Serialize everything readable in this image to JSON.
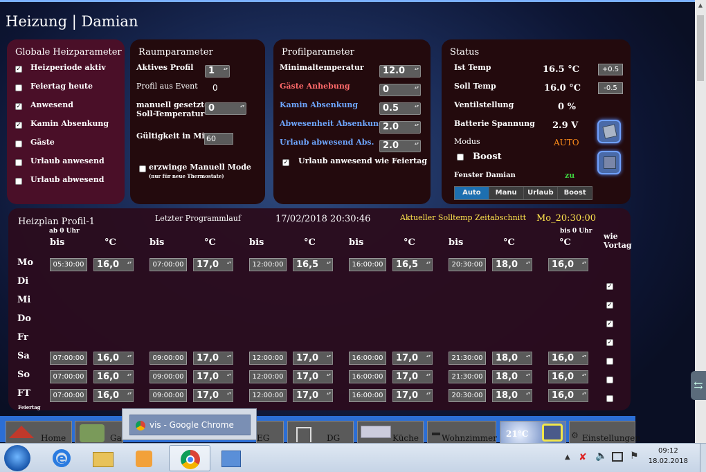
{
  "app": {
    "title": "Heizung | Damian"
  },
  "global_params": {
    "title": "Globale Heizparameter",
    "items": [
      {
        "label": "Heizperiode aktiv",
        "checked": true
      },
      {
        "label": "Feiertag heute",
        "checked": false
      },
      {
        "label": "Anwesend",
        "checked": true
      },
      {
        "label": "Kamin Absenkung",
        "checked": true
      },
      {
        "label": "Gäste",
        "checked": false
      },
      {
        "label": "Urlaub anwesend",
        "checked": false
      },
      {
        "label": "Urlaub abwesend",
        "checked": false
      }
    ]
  },
  "room_params": {
    "title": "Raumparameter",
    "active_profile_label": "Aktives Profil",
    "active_profile_value": "1",
    "profile_event_label": "Profil aus Event",
    "profile_event_value": "0",
    "manual_temp_label_1": "manuell gesetzte",
    "manual_temp_label_2": "Soll-Temperatur",
    "manual_temp_value": "0",
    "validity_label": "Gültigkeit in Min",
    "validity_value": "60",
    "force_manual_label": "erzwinge Manuell Mode",
    "force_manual_note": "(nur für neue Thermostate)"
  },
  "profile_params": {
    "title": "Profilparameter",
    "min_temp_label": "Minimaltemperatur",
    "min_temp_value": "12.0",
    "guest_raise_label": "Gäste Anhebung",
    "guest_raise_value": "0",
    "kamin_label": "Kamin Absenkung",
    "kamin_value": "0.5",
    "absence_label": "Abwesenheit Absenkung",
    "absence_value": "2.0",
    "vacation_away_label": "Urlaub abwesend Abs.",
    "vacation_away_value": "2.0",
    "vacation_holiday_label": "Urlaub anwesend wie Feiertag"
  },
  "status": {
    "title": "Status",
    "ist_label": "Ist Temp",
    "ist_value": "16.5 °C",
    "soll_label": "Soll Temp",
    "soll_value": "16.0 °C",
    "plus_label": "+0.5",
    "minus_label": "-0.5",
    "valve_label": "Ventilstellung",
    "valve_value": "0 %",
    "battery_label": "Batterie Spannung",
    "battery_value": "2.9 V",
    "mode_label": "Modus",
    "mode_value": "AUTO",
    "boost_label": "Boost",
    "window_label": "Fenster Damian",
    "window_value": "zu",
    "mode_buttons": [
      "Auto",
      "Manu",
      "Urlaub",
      "Boost"
    ],
    "colors": {
      "mode": "#ff8c1a",
      "window": "#3fd23f",
      "active_mode": "#1d6fb0"
    }
  },
  "schedule": {
    "title": "Heizplan Profil-1",
    "last_run_label": "Letzter Programmlauf",
    "last_run_value": "17/02/2018 20:30:46",
    "current_label": "Aktueller Solltemp Zeitabschnitt",
    "current_value": "Mo_20:30:00",
    "from_label": "ab 0 Uhr",
    "to_label": "bis 0 Uhr",
    "bis": "bis",
    "celsius": "°C",
    "like_prev_1": "wie",
    "like_prev_2": "Vortag",
    "holiday_note": "Feiertag",
    "days": [
      {
        "name": "Mo",
        "times": [
          "05:30:00",
          "07:00:00",
          "12:00:00",
          "16:00:00",
          "20:30:00"
        ],
        "temps": [
          "16,0",
          "17,0",
          "16,5",
          "16,5",
          "18,0",
          "16,0"
        ],
        "like_prev": null
      },
      {
        "name": "Di",
        "like_prev": true
      },
      {
        "name": "Mi",
        "like_prev": true
      },
      {
        "name": "Do",
        "like_prev": true
      },
      {
        "name": "Fr",
        "like_prev": true
      },
      {
        "name": "Sa",
        "times": [
          "07:00:00",
          "09:00:00",
          "12:00:00",
          "16:00:00",
          "21:30:00"
        ],
        "temps": [
          "16,0",
          "17,0",
          "17,0",
          "17,0",
          "18,0",
          "16,0"
        ],
        "like_prev": false
      },
      {
        "name": "So",
        "times": [
          "07:00:00",
          "09:00:00",
          "12:00:00",
          "16:00:00",
          "21:30:00"
        ],
        "temps": [
          "16,0",
          "17,0",
          "17,0",
          "17,0",
          "18,0",
          "16,0"
        ],
        "like_prev": false
      },
      {
        "name": "FT",
        "times": [
          "07:00:00",
          "09:00:00",
          "12:00:00",
          "16:00:00",
          "20:30:00"
        ],
        "temps": [
          "16,0",
          "17,0",
          "17,0",
          "17,0",
          "18,0",
          "16,0"
        ],
        "like_prev": false
      }
    ]
  },
  "nav": {
    "items": [
      "Home",
      "Ga",
      "EG",
      "DG",
      "Küche",
      "Wohnzimmer",
      "21°C",
      "Einstellungen"
    ]
  },
  "taskbar": {
    "popup_label": "vis - Google Chrome",
    "time": "09:12",
    "date": "18.02.2018"
  }
}
